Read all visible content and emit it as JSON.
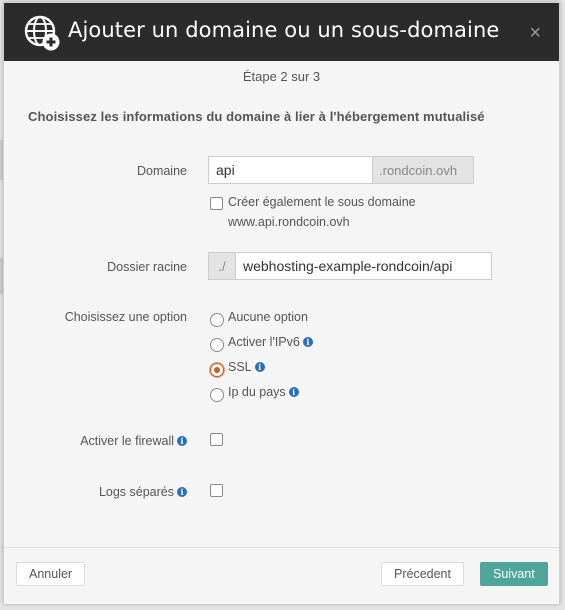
{
  "dialog": {
    "title": "Ajouter un domaine ou un sous-domaine",
    "close_icon": "×",
    "step": "Étape 2 sur 3",
    "intro": "Choisissez les informations du domaine à lier à l'hébergement mutualisé"
  },
  "form": {
    "domain_label": "Domaine",
    "domain_value": "api",
    "domain_suffix": ".rondcoin.ovh",
    "subdomain_checkbox_line1": "Créer également le sous domaine",
    "subdomain_checkbox_line2": "www.api.rondcoin.ovh",
    "root_label": "Dossier racine",
    "root_prefix": "./",
    "root_value": "webhosting-example-rondcoin/api",
    "option_label": "Choisissez une option",
    "options": [
      {
        "label": "Aucune option",
        "info": false,
        "checked": false
      },
      {
        "label": "Activer l'IPv6",
        "info": true,
        "checked": false
      },
      {
        "label": "SSL",
        "info": true,
        "checked": true
      },
      {
        "label": "Ip du pays",
        "info": true,
        "checked": false
      }
    ],
    "firewall_label": "Activer le firewall",
    "logs_label": "Logs séparés",
    "info_glyph": "i"
  },
  "footer": {
    "cancel": "Annuler",
    "previous": "Précedent",
    "next": "Suivant"
  },
  "colors": {
    "header_bg": "#2b2b2b",
    "primary": "#4fa59b",
    "radio_checked": "#c0622b",
    "info": "#2a6fb5"
  },
  "icons": {
    "header": "globe-plus-icon",
    "close": "close-icon",
    "info": "info-icon"
  }
}
